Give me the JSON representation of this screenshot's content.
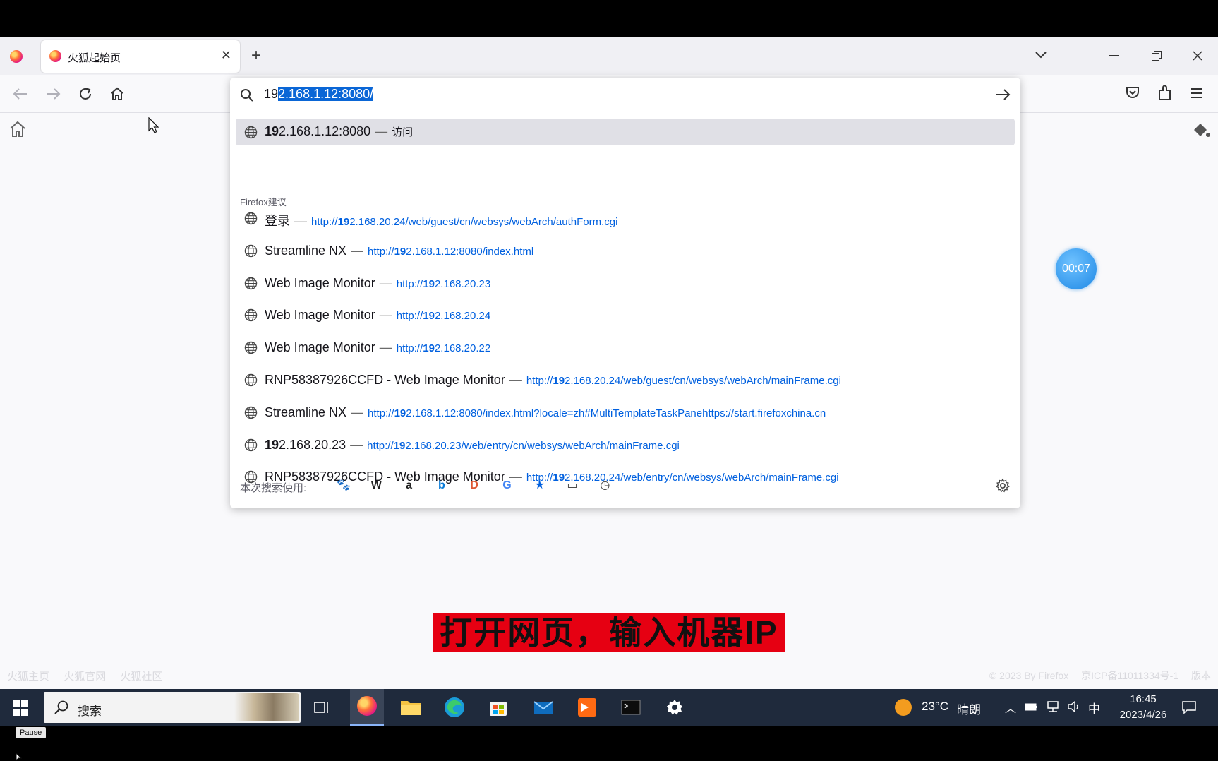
{
  "browser": {
    "tab_title": "火狐起始页",
    "new_tab_symbol": "+",
    "close_symbol": "✕"
  },
  "urlbar": {
    "typed": "19",
    "autofilled": "2.168.1.12:8080/"
  },
  "heuristic": {
    "bold": "19",
    "rest": "2.168.1.12:8080",
    "action": "访问"
  },
  "suggestions_label": "Firefox建议",
  "suggestions": [
    {
      "title": "登录",
      "url_prefix": "http://",
      "url_bold": "19",
      "url_rest": "2.168.20.24/web/guest/cn/websys/webArch/authForm.cgi"
    },
    {
      "title": "Streamline NX",
      "url_prefix": "http://",
      "url_bold": "19",
      "url_rest": "2.168.1.12:8080/index.html"
    },
    {
      "title": "Web Image Monitor",
      "url_prefix": "http://",
      "url_bold": "19",
      "url_rest": "2.168.20.23"
    },
    {
      "title": "Web Image Monitor",
      "url_prefix": "http://",
      "url_bold": "19",
      "url_rest": "2.168.20.24"
    },
    {
      "title": "Web Image Monitor",
      "url_prefix": "http://",
      "url_bold": "19",
      "url_rest": "2.168.20.22"
    },
    {
      "title": "RNP58387926CCFD - Web Image Monitor",
      "url_prefix": "http://",
      "url_bold": "19",
      "url_rest": "2.168.20.24/web/guest/cn/websys/webArch/mainFrame.cgi"
    },
    {
      "title": "Streamline NX",
      "url_prefix": "http://",
      "url_bold": "19",
      "url_rest": "2.168.1.12:8080/index.html?locale=zh#MultiTemplateTaskPanehttps://start.firefoxchina.cn"
    },
    {
      "title_bold": "19",
      "title": "2.168.20.23",
      "url_prefix": "http://",
      "url_bold": "19",
      "url_rest": "2.168.20.23/web/entry/cn/websys/webArch/mainFrame.cgi"
    },
    {
      "title": "RNP58387926CCFD - Web Image Monitor",
      "url_prefix": "http://",
      "url_bold": "19",
      "url_rest": "2.168.20.24/web/entry/cn/websys/webArch/mainFrame.cgi"
    }
  ],
  "search_engines_label": "本次搜索使用:",
  "search_engines": [
    {
      "name": "baidu-icon",
      "glyph": "🐾",
      "color": "#2932e1"
    },
    {
      "name": "wikipedia-icon",
      "glyph": "W",
      "color": "#222222"
    },
    {
      "name": "amazon-icon",
      "glyph": "a",
      "color": "#222222"
    },
    {
      "name": "bing-icon",
      "glyph": "b",
      "color": "#0a7cd8"
    },
    {
      "name": "duckduckgo-icon",
      "glyph": "D",
      "color": "#de5833"
    },
    {
      "name": "google-icon",
      "glyph": "G",
      "color": "#4285f4"
    },
    {
      "name": "bookmarks-icon",
      "glyph": "★",
      "color": "#0060df"
    },
    {
      "name": "tabs-icon",
      "glyph": "▭",
      "color": "#333333"
    },
    {
      "name": "history-icon",
      "glyph": "◷",
      "color": "#333333"
    }
  ],
  "timer": "00:07",
  "caption": "打开网页，输入机器IP",
  "footer_links": [
    "火狐主页",
    "火狐官网",
    "火狐社区"
  ],
  "footer_right": [
    "© 2023 By Firefox",
    "京ICP备11011334号-1",
    "版本"
  ],
  "taskbar": {
    "search_placeholder": "搜索",
    "weather": "23°C",
    "weather_desc": "晴朗",
    "ime": "中",
    "time": "16:45",
    "date": "2023/4/26"
  },
  "pause_label": "Pause",
  "colors": {
    "accent": "#0060df",
    "selection": "#0a66d6",
    "caption_bg": "#e60012",
    "taskbar_bg": "#1f2a3c"
  }
}
